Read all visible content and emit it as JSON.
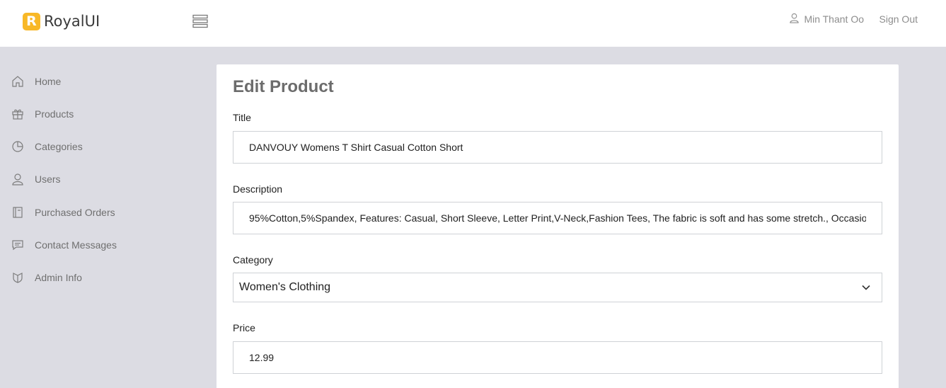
{
  "header": {
    "brand_initial": "R",
    "brand_name": "RoyalUI",
    "user_name": "Min Thant Oo",
    "signout_label": "Sign Out",
    "brand_color": "#f8b827"
  },
  "sidebar": {
    "items": [
      {
        "label": "Home",
        "icon": "home-icon"
      },
      {
        "label": "Products",
        "icon": "gift-icon"
      },
      {
        "label": "Categories",
        "icon": "pie-chart-icon"
      },
      {
        "label": "Users",
        "icon": "user-icon"
      },
      {
        "label": "Purchased Orders",
        "icon": "book-icon"
      },
      {
        "label": "Contact Messages",
        "icon": "message-icon"
      },
      {
        "label": "Admin Info",
        "icon": "shield-icon"
      }
    ]
  },
  "form": {
    "title": "Edit Product",
    "title_label": "Title",
    "title_value": "DANVOUY Womens T Shirt Casual Cotton Short",
    "description_label": "Description",
    "description_value": "95%Cotton,5%Spandex, Features: Casual, Short Sleeve, Letter Print,V-Neck,Fashion Tees, The fabric is soft and has some stretch., Occasio",
    "category_label": "Category",
    "category_value": "Women's Clothing",
    "price_label": "Price",
    "price_value": "12.99"
  }
}
